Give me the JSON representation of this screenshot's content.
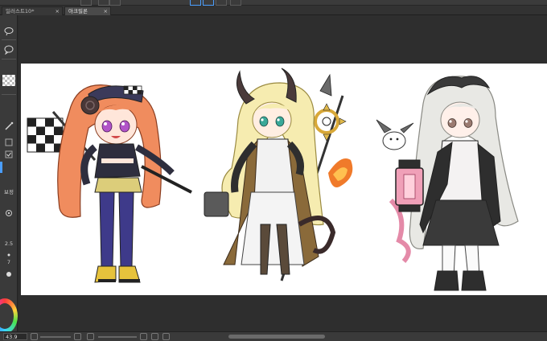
{
  "tabs": [
    {
      "label": "일러스트10*",
      "active": false
    },
    {
      "label": "아크릴론",
      "active": true
    }
  ],
  "tab_close_glyph": "×",
  "left_toolbar": {
    "labels": [
      "보정",
      "2.5",
      "7"
    ],
    "icons": [
      "lasso-icon",
      "lasso-icon",
      "speech-bubble-icon",
      "transparent-color-swatch",
      "brush-icon",
      "checkbox-icon",
      "checkbox-icon",
      "settings-icon",
      "settings-icon",
      "dot-icon",
      "color-wheel-icon"
    ]
  },
  "status_bar": {
    "zoom": "43.9",
    "icons": [
      "zoom-out-icon",
      "zoom-in-icon",
      "fit-icon",
      "rotate-icon",
      "reset-icon",
      "flip-icon"
    ]
  },
  "canvas": {
    "characters": [
      "racing-flag-girl",
      "horned-staff-girl",
      "lantern-girl"
    ],
    "colors": {
      "paper": "#ffffff",
      "workspace": "#2e2e2e",
      "accent": "#4a9eff"
    }
  }
}
